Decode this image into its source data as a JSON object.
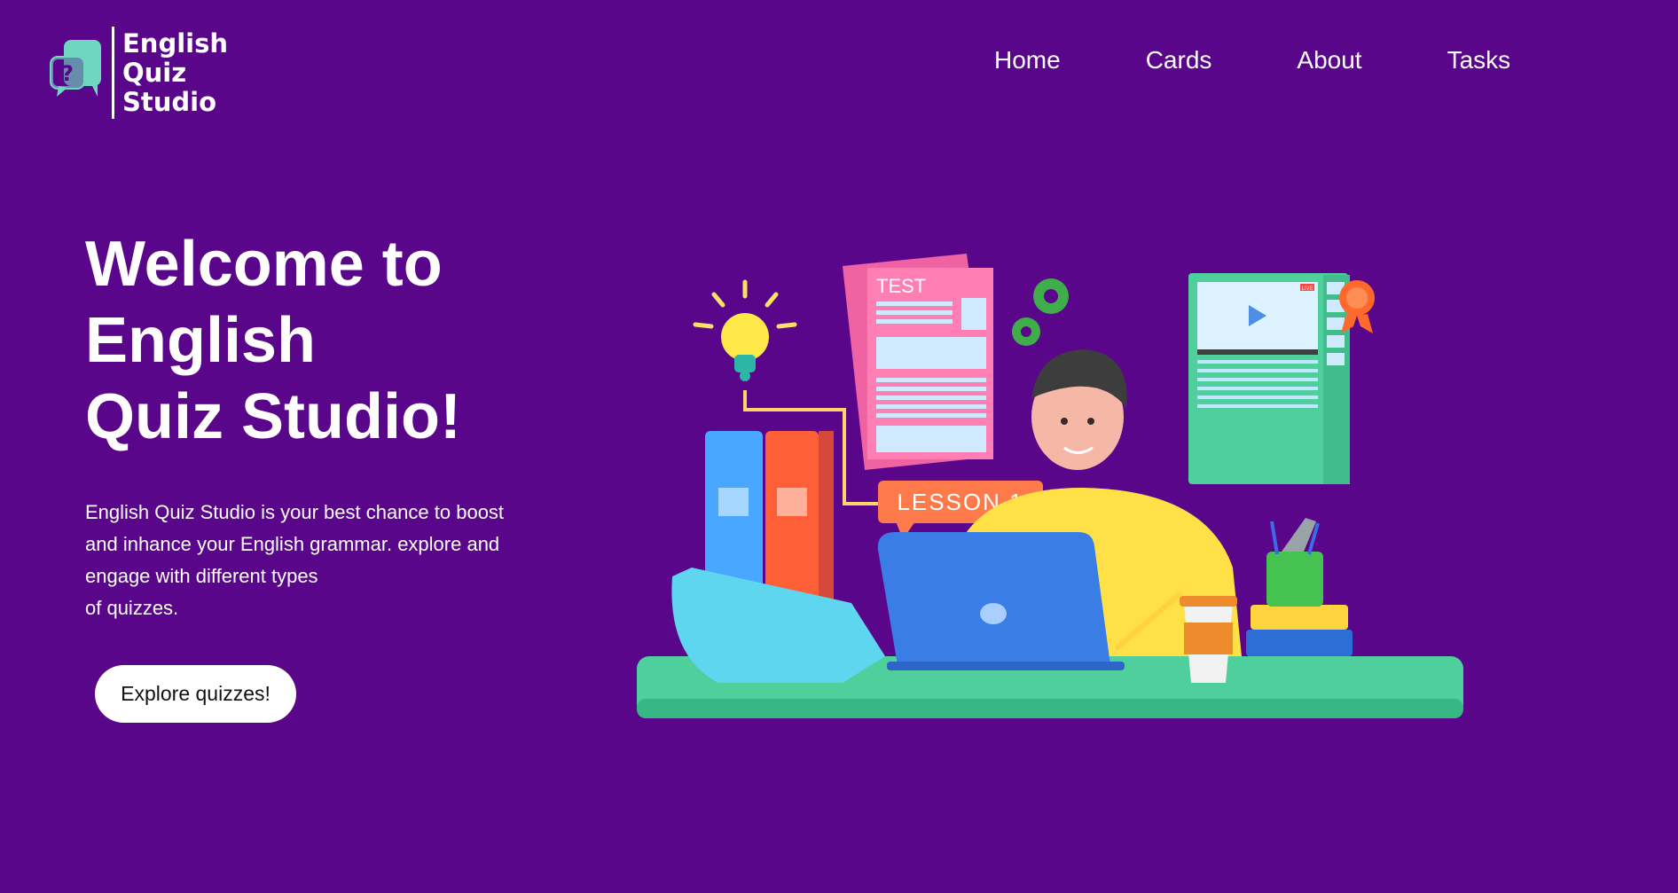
{
  "header": {
    "logo": {
      "line1": "English",
      "line2": "Quiz",
      "line3": "Studio",
      "icon": "speech-bubble-question-icon"
    },
    "nav": [
      {
        "label": "Home"
      },
      {
        "label": "Cards"
      },
      {
        "label": "About"
      },
      {
        "label": "Tasks"
      }
    ]
  },
  "hero": {
    "title_lines": [
      "Welcome to",
      "English",
      "Quiz Studio!"
    ],
    "description_lines": [
      "English Quiz Studio is your best chance to boost",
      "and inhance your English grammar. explore and",
      "engage with different types",
      "of quizzes."
    ],
    "cta_label": "Explore quizzes!"
  },
  "illustration": {
    "test_label": "TEST",
    "lesson_label": "LESSON 1",
    "live_label": "LIVE"
  },
  "colors": {
    "background": "#5a068a",
    "text": "#ffffff",
    "logo_accent": "#6fd6c0",
    "button_bg": "#ffffff"
  }
}
